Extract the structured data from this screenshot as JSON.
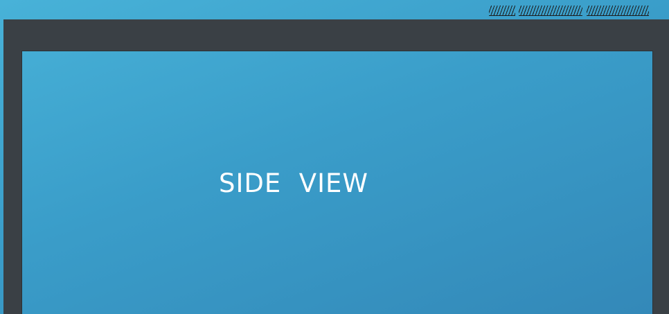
{
  "diagram": {
    "title": "SIDE  VIEW",
    "colors": {
      "background_light": "#48b2d8",
      "background_dark": "#3388b8",
      "frame": "#3a4045",
      "hatching": "#1c1c1c",
      "title_text": "#ffffff"
    }
  }
}
